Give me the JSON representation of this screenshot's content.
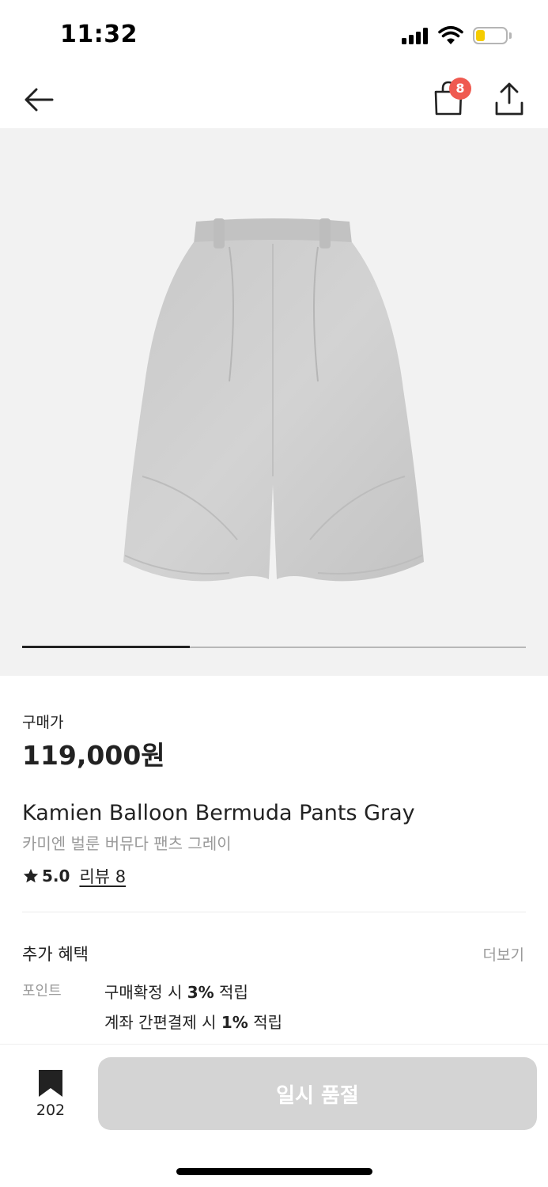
{
  "status_bar": {
    "time": "11:32",
    "signal_icon": "cellular-signal-icon",
    "wifi_icon": "wifi-icon",
    "battery_icon": "battery-icon",
    "battery_level": 0.3,
    "battery_color": "#f5cc00"
  },
  "nav": {
    "back_icon": "arrow-left-icon",
    "bag_icon": "shopping-bag-icon",
    "bag_count": "8",
    "badge_color": "#ef5a50",
    "share_icon": "share-icon"
  },
  "gallery": {
    "image_subject": "gray balloon bermuda pants",
    "progress": 0.333
  },
  "product": {
    "price_label": "구매가",
    "price": "119,000원",
    "name_en": "Kamien Balloon Bermuda Pants Gray",
    "name_ko": "카미엔 벌룬 버뮤다 팬츠 그레이",
    "rating": "5.0",
    "review_link": "리뷰 8"
  },
  "benefits": {
    "title": "추가 혜택",
    "more": "더보기",
    "point_label": "포인트",
    "lines": [
      {
        "pre": "구매확정 시 ",
        "bold": "3%",
        "post": " 적립"
      },
      {
        "pre": "계좌 간편결제 시 ",
        "bold": "1%",
        "post": " 적립"
      }
    ]
  },
  "bottom_bar": {
    "bookmark_icon": "bookmark-icon",
    "bookmark_count": "202",
    "soldout_label": "일시 품절",
    "soldout_color": "#d4d4d4"
  }
}
